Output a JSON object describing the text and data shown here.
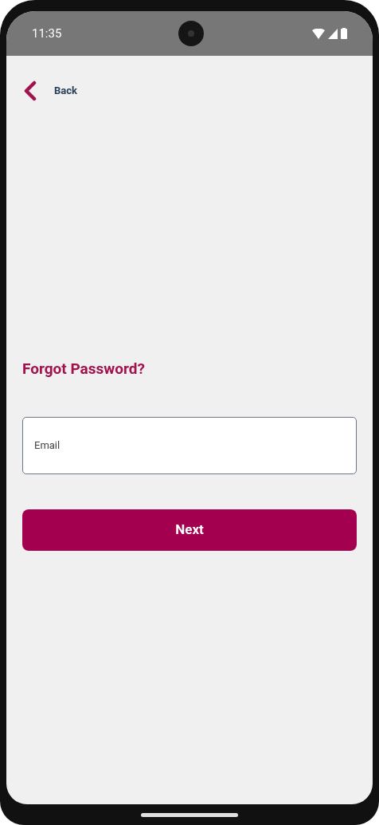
{
  "status_bar": {
    "time": "11:35"
  },
  "back": {
    "label": "Back"
  },
  "title": "Forgot Password?",
  "email_field": {
    "placeholder": "Email"
  },
  "next_button": {
    "label": "Next"
  }
}
